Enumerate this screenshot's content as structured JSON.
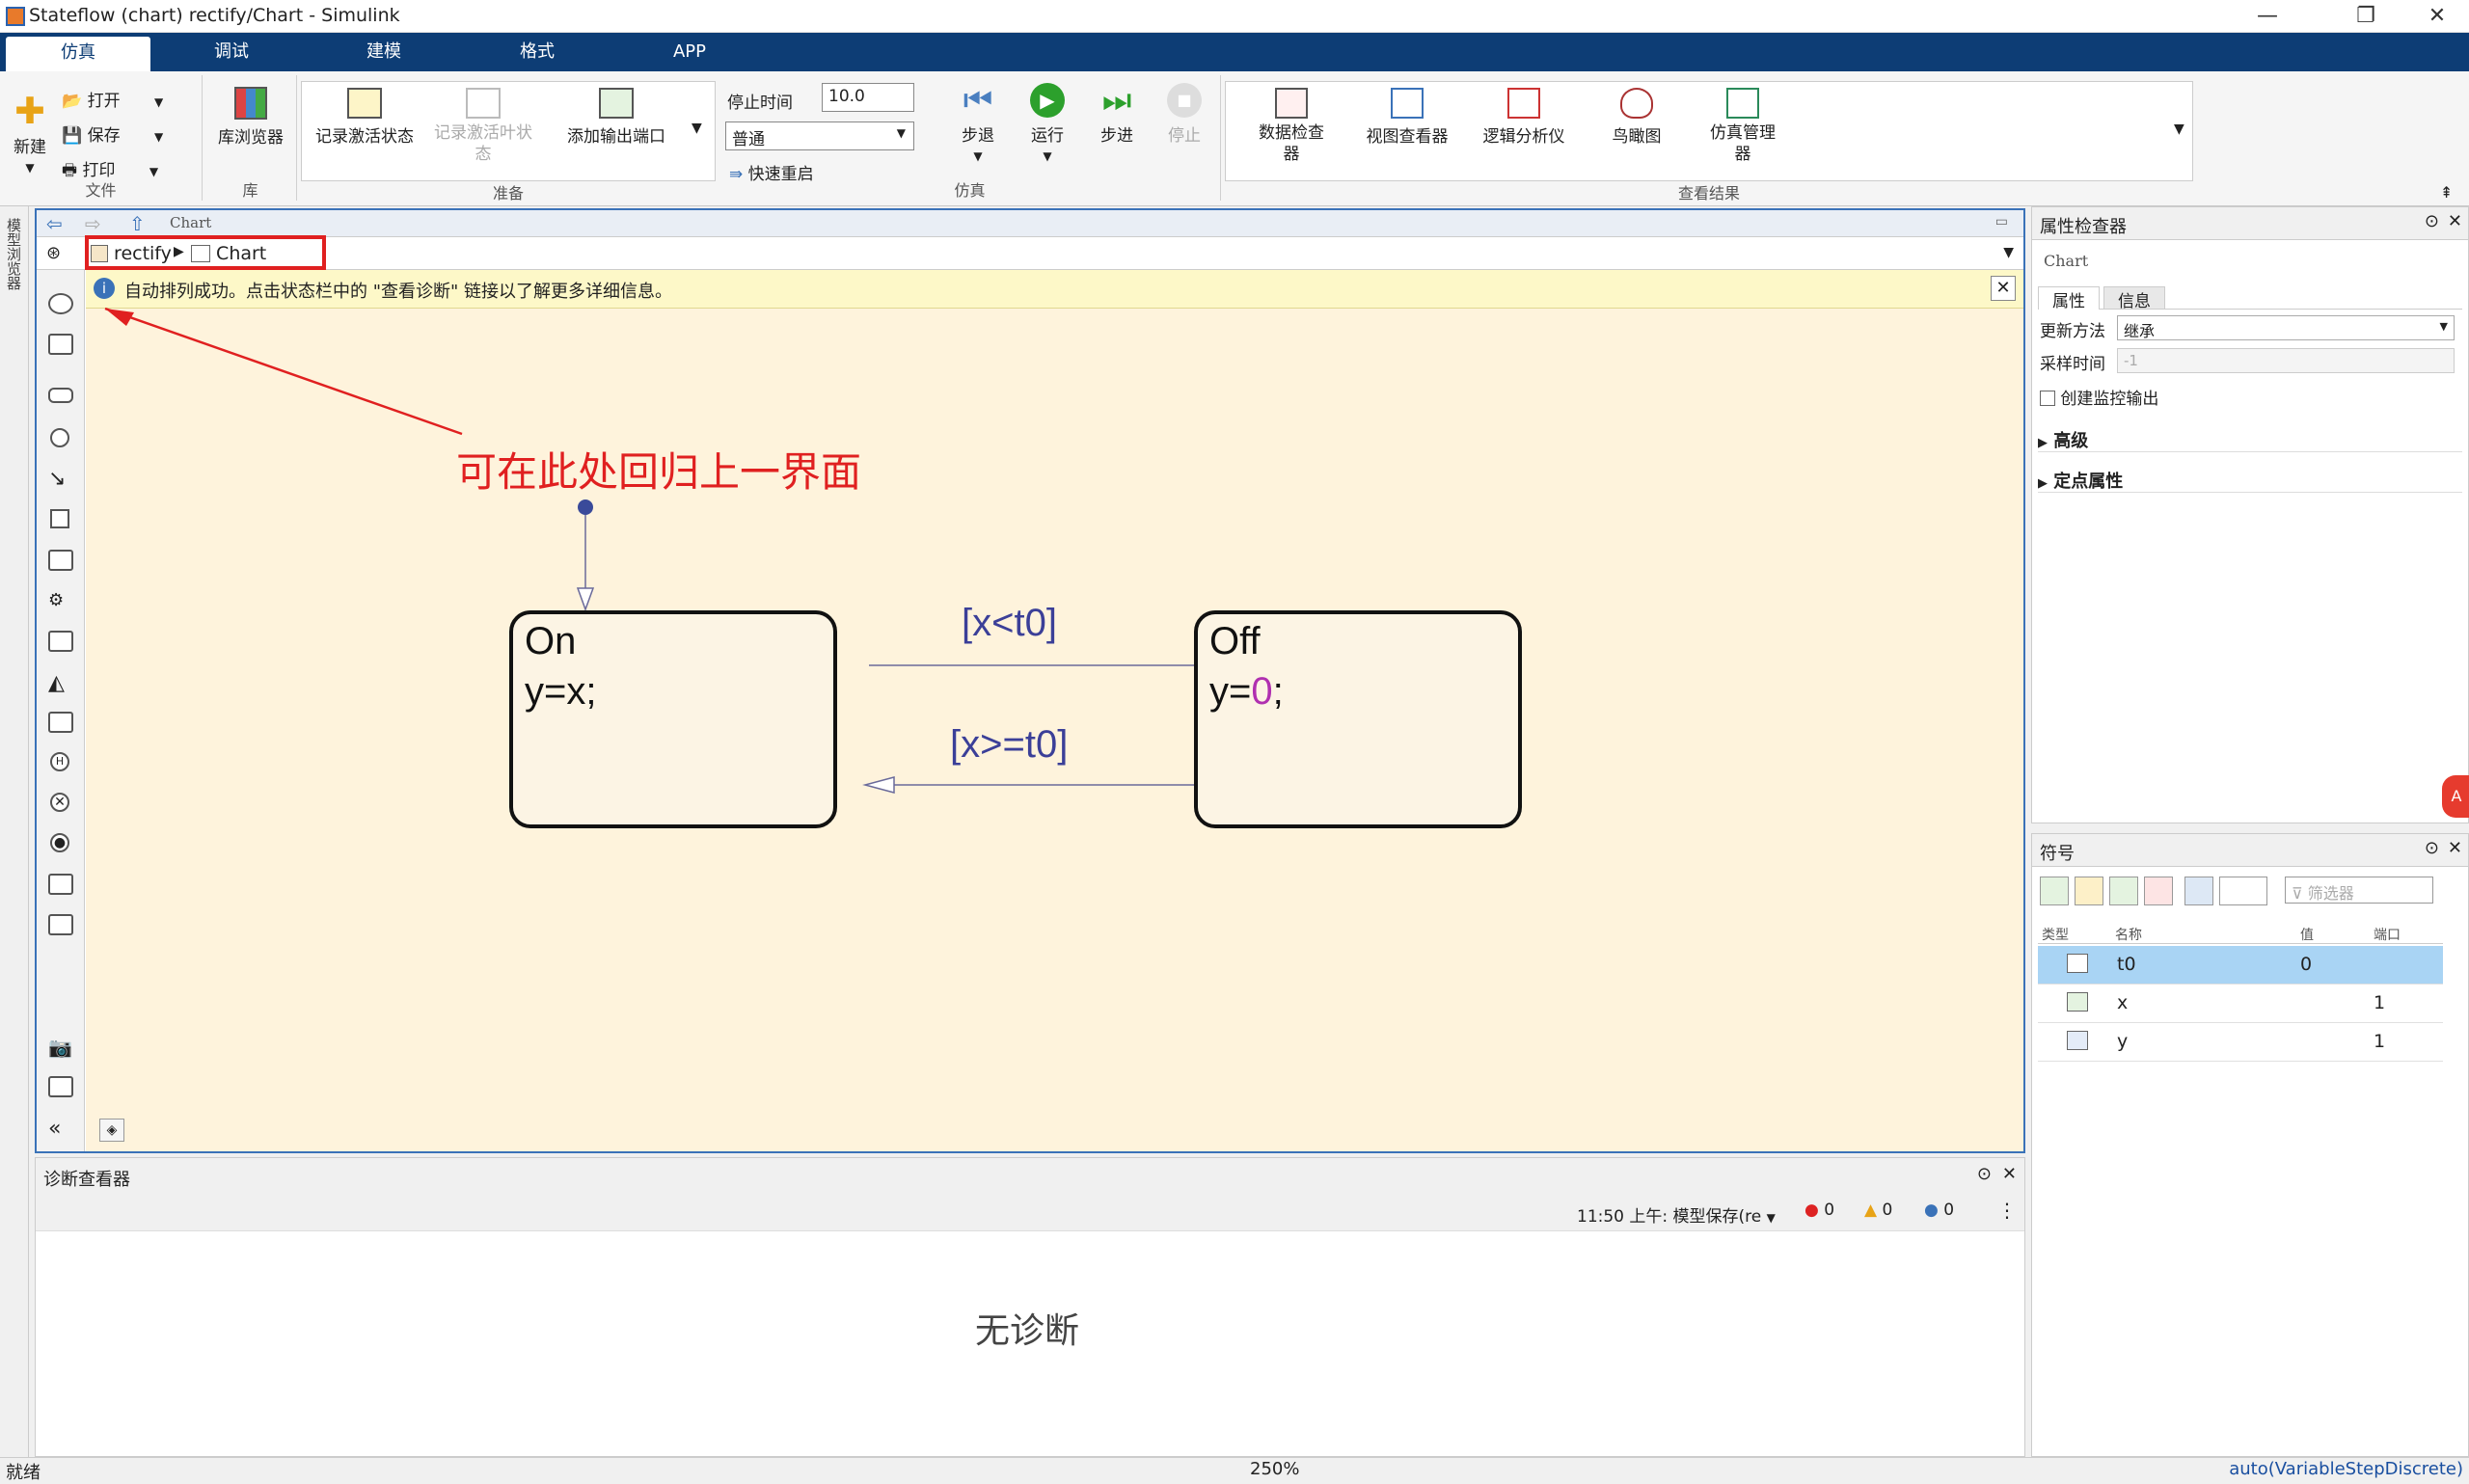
{
  "window": {
    "title": "Stateflow (chart) rectify/Chart - Simulink"
  },
  "tabs": [
    {
      "label": "仿真"
    },
    {
      "label": "调试"
    },
    {
      "label": "建模"
    },
    {
      "label": "格式"
    },
    {
      "label": "APP"
    }
  ],
  "ribbon": {
    "file": {
      "new": "新建",
      "open": "打开",
      "save": "保存",
      "print": "打印",
      "group": "文件"
    },
    "library": {
      "browser": "库浏览器",
      "group": "库"
    },
    "prepare": {
      "log_states": "记录激活状态",
      "log_leaf": "记录激活叶状态",
      "add_output": "添加输出端口",
      "group": "准备"
    },
    "simulate": {
      "stop_time_label": "停止时间",
      "stop_time_value": "10.0",
      "mode": "普通",
      "fast_restart": "快速重启",
      "step_back": "步退",
      "run": "运行",
      "step_forward": "步进",
      "stop": "停止",
      "group": "仿真"
    },
    "review": {
      "data_inspector": "数据检查器",
      "view_viewer": "视图查看器",
      "logic_analyzer": "逻辑分析仪",
      "birdseye": "鸟瞰图",
      "sim_manager": "仿真管理器",
      "group": "查看结果"
    }
  },
  "left_strip": {
    "label": "模型浏览器"
  },
  "editor": {
    "top_label": "Chart",
    "breadcrumb": [
      {
        "label": "rectify"
      },
      {
        "label": "Chart"
      }
    ],
    "notice": "自动排列成功。点击状态栏中的 \"查看诊断\" 链接以了解更多详细信息。",
    "annotation": "可在此处回归上一界面",
    "states": [
      {
        "name": "On",
        "action": "y=x;"
      },
      {
        "name": "Off",
        "action_prefix": "y=",
        "action_value": "0",
        "action_suffix": ";"
      }
    ],
    "transitions": [
      {
        "label": "[x<t0]"
      },
      {
        "label": "[x>=t0]"
      }
    ]
  },
  "diagnostics": {
    "title": "诊断查看器",
    "timestamp": "11:50 上午: 模型保存(re",
    "errors": "0",
    "warnings": "0",
    "infos": "0",
    "empty_message": "无诊断"
  },
  "property_inspector": {
    "title": "属性检查器",
    "object": "Chart",
    "tabs": [
      "属性",
      "信息"
    ],
    "update_method_label": "更新方法",
    "update_method_value": "继承",
    "sample_time_label": "采样时间",
    "sample_time_value": "-1",
    "monitor_output": "创建监控输出",
    "sections": [
      "高级",
      "定点属性"
    ]
  },
  "symbols": {
    "title": "符号",
    "filter_placeholder": "筛选器",
    "columns": [
      "类型",
      "名称",
      "值",
      "端口"
    ],
    "rows": [
      {
        "name": "t0",
        "value": "0",
        "port": ""
      },
      {
        "name": "x",
        "value": "",
        "port": "1"
      },
      {
        "name": "y",
        "value": "",
        "port": "1"
      }
    ]
  },
  "status": {
    "left": "就绪",
    "zoom": "250%",
    "solver": "auto(VariableStepDiscrete)"
  }
}
